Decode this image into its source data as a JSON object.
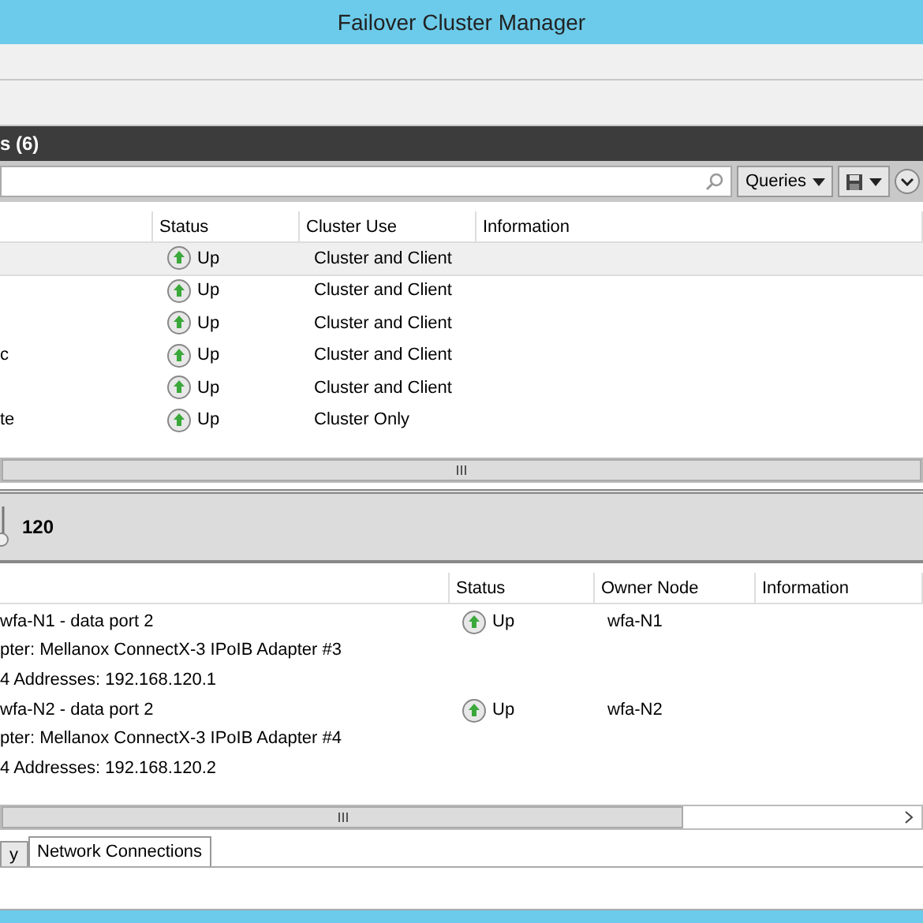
{
  "window": {
    "title": "Failover Cluster Manager"
  },
  "networks_panel": {
    "title": "s (6)",
    "search_button": "Queries",
    "columns": [
      "",
      "Status",
      "Cluster Use",
      "Information"
    ],
    "rows": [
      {
        "name": "",
        "status": "Up",
        "cluster_use": "Cluster and Client",
        "selected": true
      },
      {
        "name": "",
        "status": "Up",
        "cluster_use": "Cluster and Client",
        "selected": false
      },
      {
        "name": "",
        "status": "Up",
        "cluster_use": "Cluster and Client",
        "selected": false
      },
      {
        "name": "c",
        "status": "Up",
        "cluster_use": "Cluster and Client",
        "selected": false
      },
      {
        "name": "",
        "status": "Up",
        "cluster_use": "Cluster and Client",
        "selected": false
      },
      {
        "name": "te",
        "status": "Up",
        "cluster_use": "Cluster Only",
        "selected": false
      }
    ]
  },
  "details_panel": {
    "title": "120",
    "columns": [
      "",
      "Status",
      "Owner Node",
      "Information"
    ],
    "items": [
      {
        "name": "wfa-N1 - data port 2",
        "adapter": "pter: Mellanox ConnectX-3 IPoIB Adapter #3",
        "addresses": "4 Addresses: 192.168.120.1",
        "status": "Up",
        "owner_node": "wfa-N1"
      },
      {
        "name": "wfa-N2 - data port 2",
        "adapter": "pter: Mellanox ConnectX-3 IPoIB Adapter #4",
        "addresses": "4 Addresses: 192.168.120.2",
        "status": "Up",
        "owner_node": "wfa-N2"
      }
    ],
    "tabs": [
      {
        "label": "y",
        "selected": false
      },
      {
        "label": "Network Connections",
        "selected": true
      }
    ]
  }
}
